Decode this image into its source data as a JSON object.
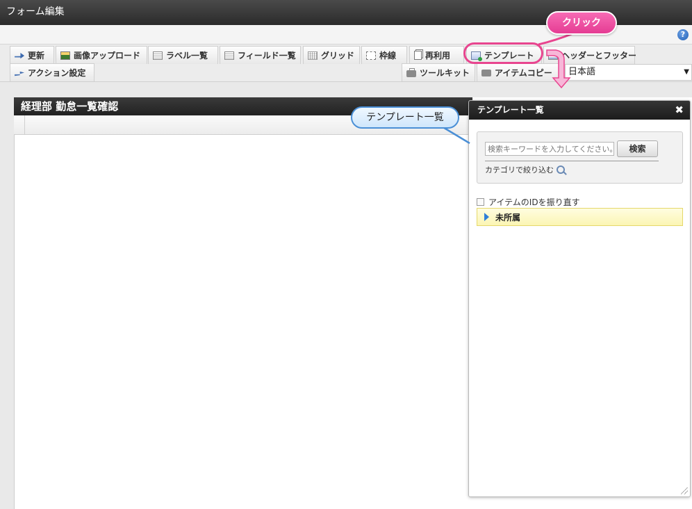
{
  "window": {
    "title": "フォーム編集"
  },
  "toolbar": {
    "row1": [
      {
        "key": "update",
        "label": "更新",
        "icon": "refresh-icon"
      },
      {
        "key": "image-upload",
        "label": "画像アップロード",
        "icon": "image-icon"
      },
      {
        "key": "label-list",
        "label": "ラベル一覧",
        "icon": "list-icon"
      },
      {
        "key": "field-list",
        "label": "フィールド一覧",
        "icon": "list-icon"
      },
      {
        "key": "grid",
        "label": "グリッド",
        "icon": "grid-icon"
      },
      {
        "key": "border",
        "label": "枠線",
        "icon": "border-icon"
      },
      {
        "key": "reuse",
        "label": "再利用",
        "icon": "document-icon"
      },
      {
        "key": "template",
        "label": "テンプレート",
        "icon": "template-icon"
      },
      {
        "key": "header-footer",
        "label": "ヘッダーとフッター",
        "icon": "header-footer-icon"
      }
    ],
    "row2": [
      {
        "key": "action-settings",
        "label": "アクション設定",
        "icon": "action-icon"
      },
      {
        "key": "toolkit",
        "label": "ツールキット",
        "icon": "toolbox-icon"
      },
      {
        "key": "item-copy",
        "label": "アイテムコピー",
        "icon": "copy-icon"
      }
    ],
    "language": {
      "selected": "日本語"
    }
  },
  "form": {
    "title": "経理部 勤怠一覧確認"
  },
  "template_panel": {
    "title": "テンプレート一覧",
    "search_placeholder": "検索キーワードを入力してください。",
    "search_button": "検索",
    "category_filter": "カテゴリで絞り込む",
    "renumber_label": "アイテムのIDを振り直す",
    "folder": "未所属"
  },
  "callouts": {
    "click": "クリック",
    "template_list": "テンプレート一覧"
  },
  "colors": {
    "accent_pink": "#e8458f",
    "callout_blue": "#4a8fd6",
    "folder_yellow": "#fbf5b4"
  }
}
